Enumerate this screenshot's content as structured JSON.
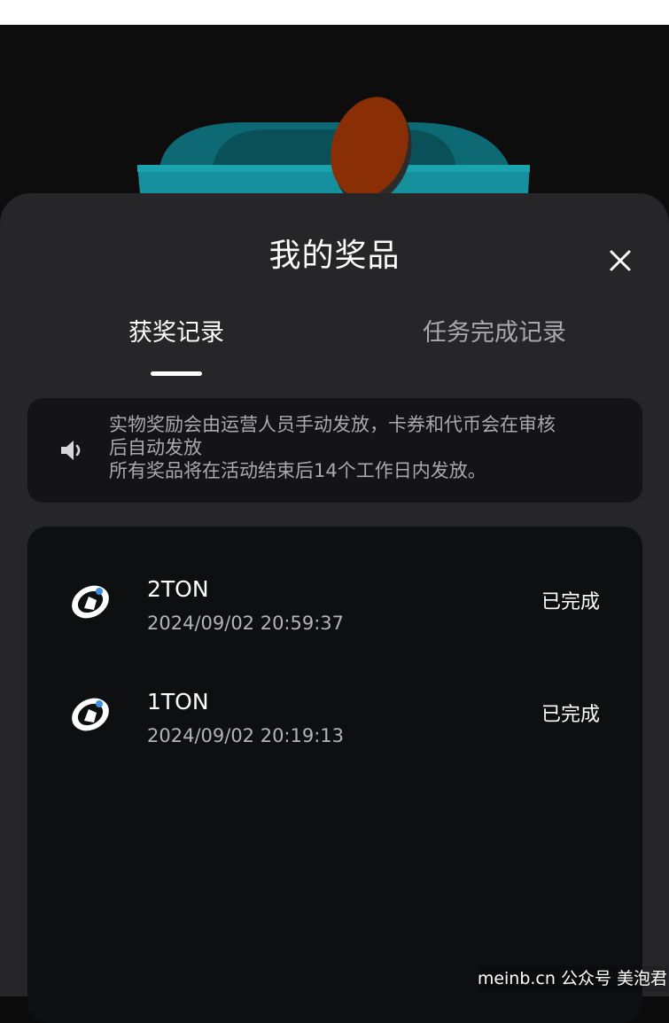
{
  "sheet": {
    "title": "我的奖品",
    "close_icon": "close-icon"
  },
  "tabs": [
    {
      "label": "获奖记录",
      "active": true
    },
    {
      "label": "任务完成记录",
      "active": false
    }
  ],
  "notice": {
    "icon": "speaker-icon",
    "lines": [
      "实物奖励会由运营人员手动发放，卡券和代币会在审核",
      "后自动发放",
      "所有奖品将在活动结束后14个工作日内发放。"
    ]
  },
  "records": [
    {
      "icon": "ton-coin-icon",
      "title": "2TON",
      "time": "2024/09/02 20:59:37",
      "status": "已完成"
    },
    {
      "icon": "ton-coin-icon",
      "title": "1TON",
      "time": "2024/09/02 20:19:13",
      "status": "已完成"
    }
  ],
  "watermark": "meinb.cn 公众号 美泡君",
  "colors": {
    "sheet_bg": "#262628",
    "card_bg": "#0e0f11",
    "accent_teal": "#0e6f78",
    "accent_coin": "#8a2f05"
  }
}
